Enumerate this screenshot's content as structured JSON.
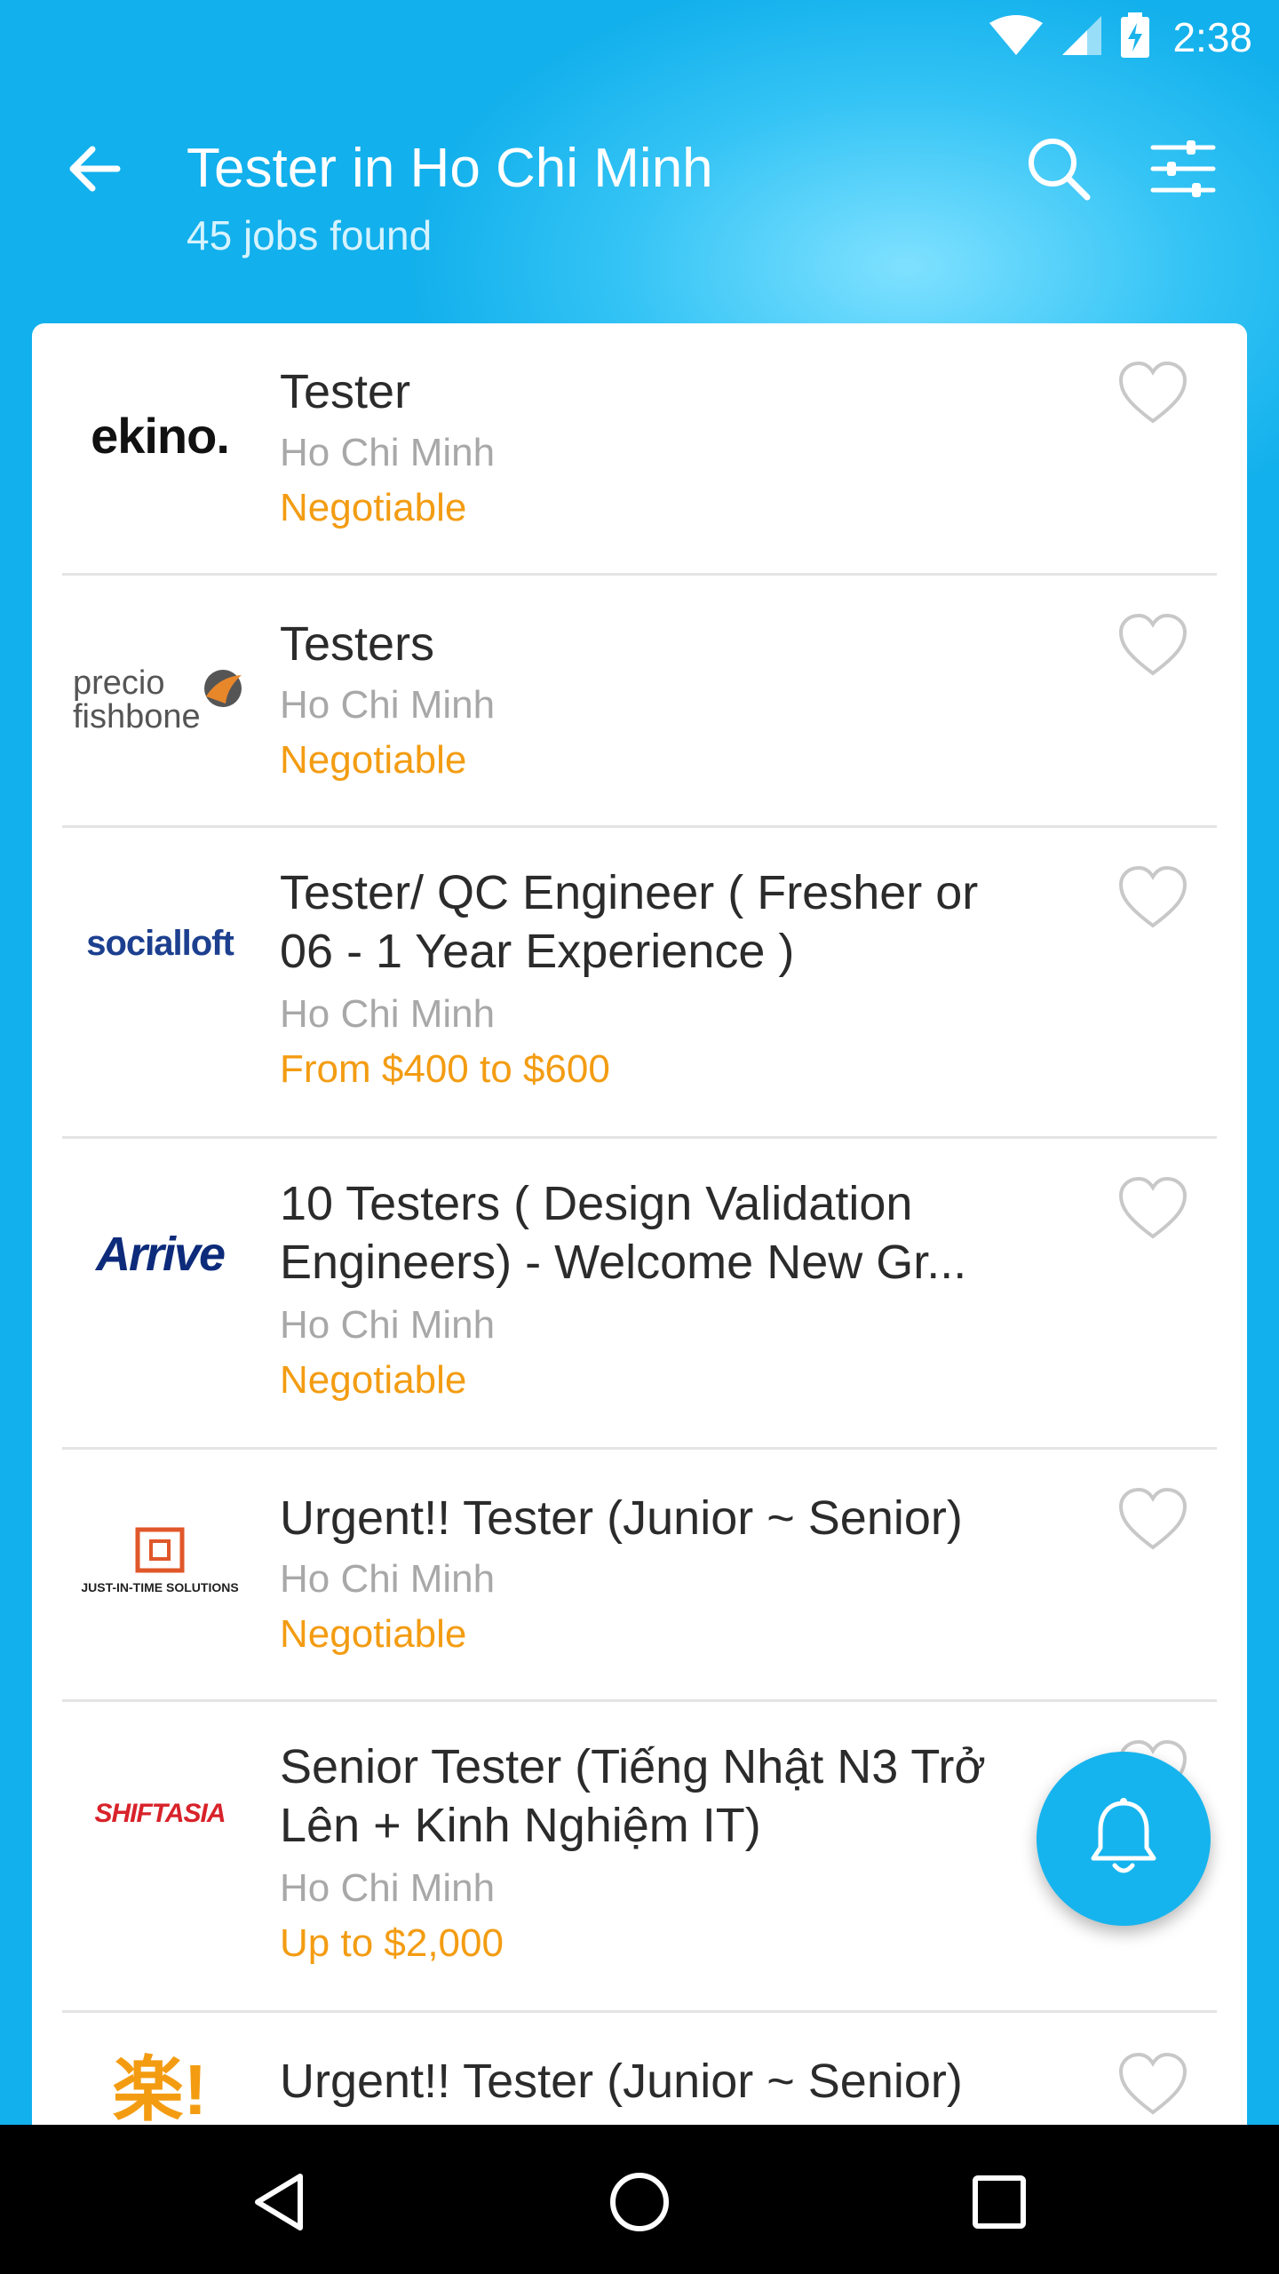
{
  "status_bar": {
    "time": "2:38",
    "icons": [
      "wifi-icon",
      "signal-icon",
      "battery-charging-icon"
    ]
  },
  "header": {
    "title": "Tester in Ho Chi Minh",
    "subtitle": "45 jobs found",
    "icons": [
      "back-arrow-icon",
      "search-icon",
      "filter-sliders-icon"
    ]
  },
  "logos": {
    "ekino": "ekino.",
    "precio_line1": "precio",
    "precio_line2": "fishbone",
    "socialloft": "socialloft",
    "arrive": "Arrive",
    "jit": "JUST-IN-TIME SOLUTIONS",
    "shiftasia": "SHIFTASIA",
    "raku": "楽!"
  },
  "jobs": [
    {
      "title": "Tester",
      "location": "Ho Chi Minh",
      "salary": "Negotiable"
    },
    {
      "title": "Testers",
      "location": "Ho Chi Minh",
      "salary": "Negotiable"
    },
    {
      "title": "Tester/ QC Engineer ( Fresher or 06 - 1 Year Experience )",
      "location": "Ho Chi Minh",
      "salary": "From $400 to $600"
    },
    {
      "title": "10 Testers ( Design Validation Engineers) - Welcome New Gr...",
      "location": "Ho Chi Minh",
      "salary": "Negotiable"
    },
    {
      "title": "Urgent!! Tester (Junior ~ Senior)",
      "location": "Ho Chi Minh",
      "salary": "Negotiable"
    },
    {
      "title": "Senior Tester (Tiếng Nhật N3 Trở Lên + Kinh Nghiệm IT)",
      "location": "Ho Chi Minh",
      "salary": "Up to $2,000"
    },
    {
      "title": "Urgent!! Tester (Junior ~ Senior)"
    }
  ],
  "fab": {
    "icon": "bell-icon"
  },
  "nav": {
    "icons": [
      "back-triangle-icon",
      "home-circle-icon",
      "recents-square-icon"
    ]
  },
  "colors": {
    "accent": "#16b4ee",
    "salary": "#f39c12",
    "title": "#2b2b2b",
    "muted": "#a8a8a8"
  }
}
